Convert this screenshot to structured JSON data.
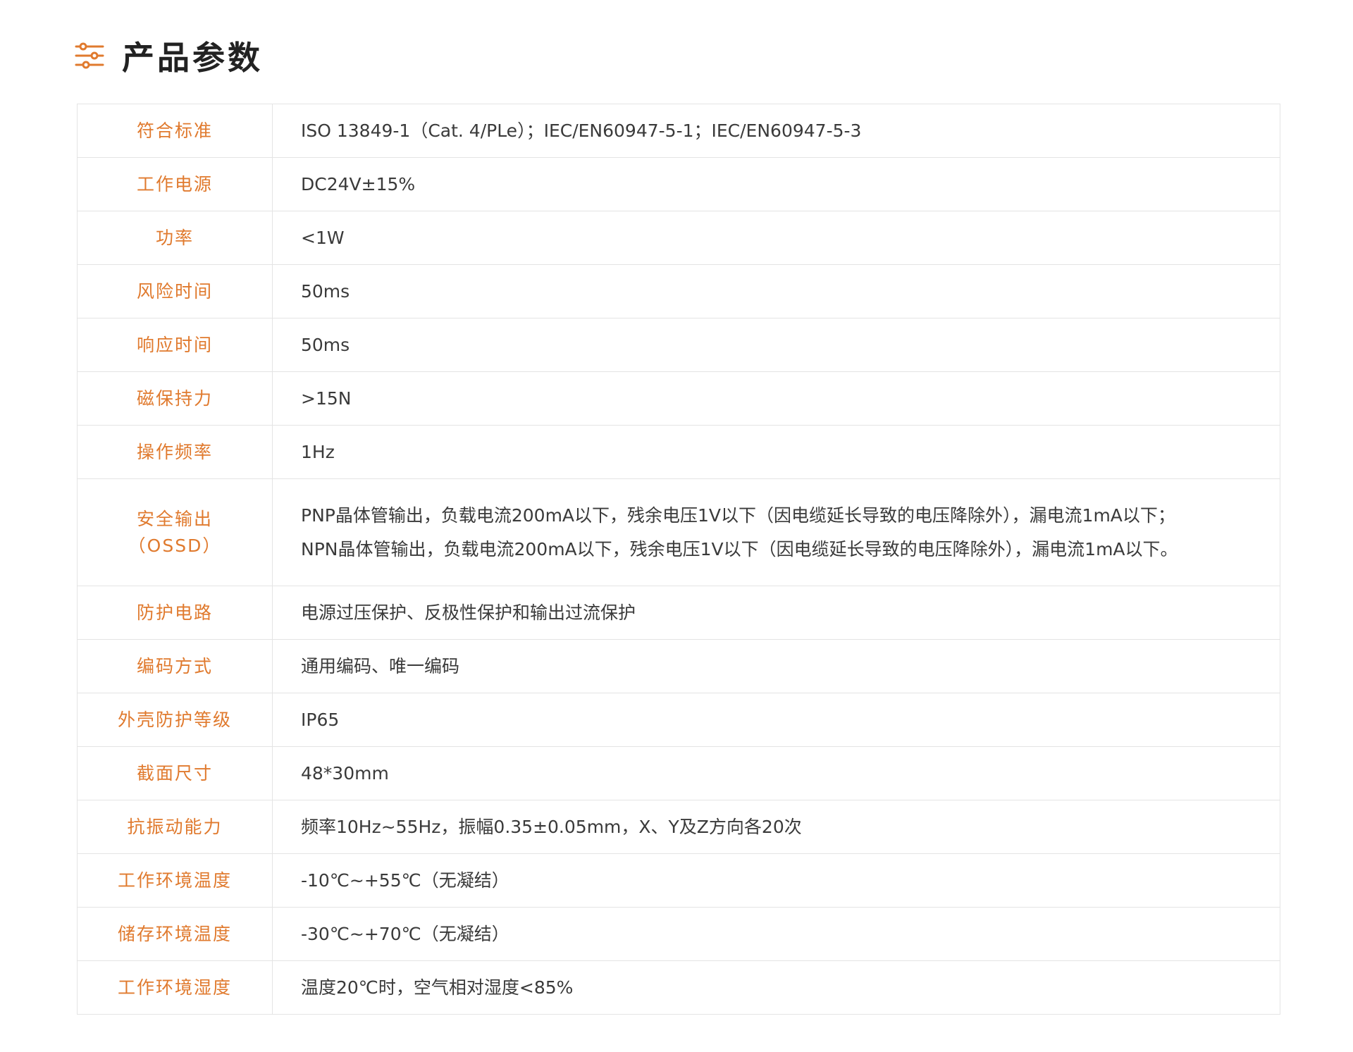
{
  "header": {
    "icon": "sliders-icon",
    "title": "产品参数",
    "accent_color": "#e07a2e"
  },
  "specs": [
    {
      "label": "符合标准",
      "value": "ISO 13849-1（Cat. 4/PLe）；IEC/EN60947-5-1；IEC/EN60947-5-3"
    },
    {
      "label": "工作电源",
      "value": "DC24V±15%"
    },
    {
      "label": "功率",
      "value": "<1W"
    },
    {
      "label": "风险时间",
      "value": "50ms"
    },
    {
      "label": "响应时间",
      "value": "50ms"
    },
    {
      "label": "磁保持力",
      "value": ">15N"
    },
    {
      "label": "操作频率",
      "value": "1Hz"
    },
    {
      "label_line1": "安全输出",
      "label_line2": "（OSSD）",
      "value_line1": "PNP晶体管输出，负载电流200mA以下，残余电压1V以下（因电缆延长导致的电压降除外），漏电流1mA以下；",
      "value_line2": "NPN晶体管输出，负载电流200mA以下，残余电压1V以下（因电缆延长导致的电压降除外），漏电流1mA以下。"
    },
    {
      "label": "防护电路",
      "value": "电源过压保护、反极性保护和输出过流保护"
    },
    {
      "label": "编码方式",
      "value": "通用编码、唯一编码"
    },
    {
      "label": "外壳防护等级",
      "value": "IP65"
    },
    {
      "label": "截面尺寸",
      "value": "48*30mm"
    },
    {
      "label": "抗振动能力",
      "value": "频率10Hz~55Hz，振幅0.35±0.05mm，X、Y及Z方向各20次"
    },
    {
      "label": "工作环境温度",
      "value": "-10℃~+55℃（无凝结）"
    },
    {
      "label": "储存环境温度",
      "value": "-30℃~+70℃（无凝结）"
    },
    {
      "label": "工作环境湿度",
      "value": "温度20℃时，空气相对湿度<85%"
    }
  ]
}
